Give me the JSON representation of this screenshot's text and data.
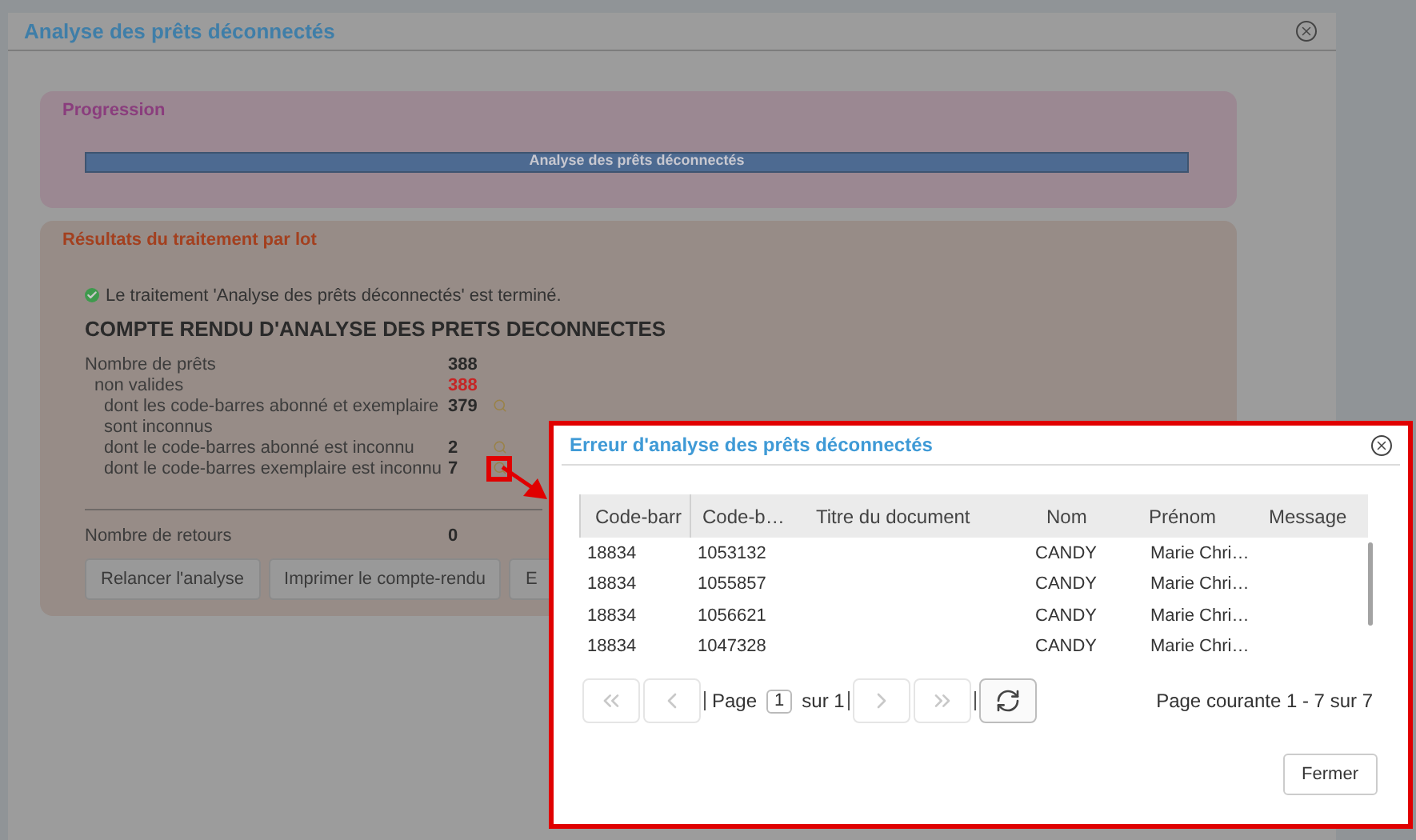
{
  "window": {
    "title": "Analyse des prêts déconnectés"
  },
  "progress": {
    "title": "Progression",
    "bar_label": "Analyse des prêts déconnectés",
    "level": 1
  },
  "results": {
    "title": "Résultats du traitement par lot",
    "status": "Le traitement 'Analyse des prêts déconnectés' est terminé.",
    "report_title": "COMPTE RENDU D'ANALYSE DES PRETS DECONNECTES",
    "rows": [
      {
        "kind": "total",
        "label": "Nombre de prêts",
        "value": "388"
      },
      {
        "kind": "invalid",
        "label": "non valides",
        "value": "388"
      },
      {
        "kind": "detail",
        "label": "dont les code-barres abonné et exemplaire sont inconnus",
        "value": "379",
        "highlighted": false
      },
      {
        "kind": "detail",
        "label": "dont le code-barres abonné est inconnu",
        "value": "2",
        "highlighted": false
      },
      {
        "kind": "detail",
        "label": "dont le code-barres exemplaire est inconnu",
        "value": "7",
        "highlighted": true
      }
    ],
    "returns": {
      "label": "Nombre de retours",
      "value": "0"
    },
    "buttons": [
      "Relancer l'analyse",
      "Imprimer le compte-rendu",
      "E"
    ]
  },
  "dialog": {
    "title": "Erreur d'analyse des prêts déconnectés",
    "columns": [
      "Code-barr",
      "Code-b…",
      "Titre du document",
      "Nom",
      "Prénom",
      "Message"
    ],
    "rows": [
      [
        "18834",
        "1053132",
        "",
        "CANDY",
        "Marie Chri…",
        ""
      ],
      [
        "18834",
        "1055857",
        "",
        "CANDY",
        "Marie Chri…",
        ""
      ],
      [
        "18834",
        "1056621",
        "",
        "CANDY",
        "Marie Chri…",
        ""
      ],
      [
        "18834",
        "1047328",
        "",
        "CANDY",
        "Marie Chri…",
        ""
      ]
    ],
    "pager": {
      "buttons": [
        {
          "kind": "first",
          "disabled": true
        },
        {
          "kind": "prev",
          "disabled": true
        },
        {
          "kind": "next",
          "disabled": true
        },
        {
          "kind": "last",
          "disabled": true
        },
        {
          "kind": "refresh",
          "disabled": false
        }
      ],
      "page_label": "Page",
      "page_value": "1",
      "of_label": "sur 1",
      "summary": "Page courante 1 - 7 sur 7"
    },
    "close_button": "Fermer"
  }
}
